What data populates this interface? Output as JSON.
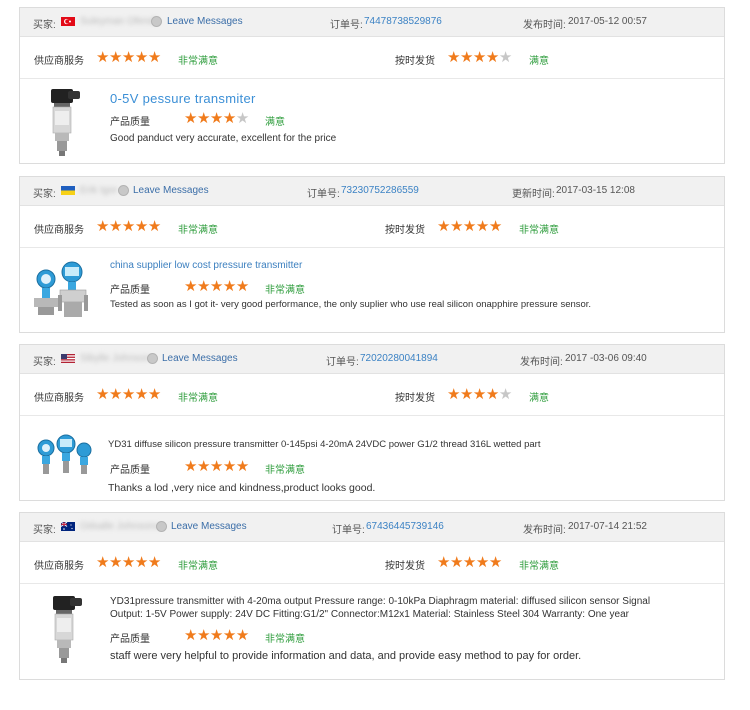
{
  "labels": {
    "buyer": "买家:",
    "leave_messages": "Leave Messages",
    "order_no": "订单号:",
    "supplier_service": "供应商服务",
    "on_time": "按时发货",
    "product_quality": "产品质量"
  },
  "colors": {
    "star_on": "#f07b1c",
    "star_off": "#c7c7c7",
    "verdict": "#2f9d3d",
    "link": "#3b82c4"
  },
  "reviews": [
    {
      "buyer_country": "turkey-flag-icon",
      "buyer_name": "Suleyman Ofendi",
      "order_number": "74478738529876",
      "date_label": "发布时间:",
      "date_value": "2017-05-12 00:57",
      "supplier_stars": 5,
      "supplier_verdict": "非常满意",
      "delivery_stars": 4,
      "delivery_verdict": "满意",
      "product_title": "0-5V  pessure  transmiter",
      "quality_stars": 4,
      "quality_verdict": "满意",
      "review_text": "Good panduct very accurate, excellent for the price",
      "thumb": "pressure-transmitter-image"
    },
    {
      "buyer_country": "ukraine-flag-icon",
      "buyer_name": "Erik Igor",
      "order_number": "73230752286559",
      "date_label": "更新时间:",
      "date_value": "2017-03-15 12:08",
      "supplier_stars": 5,
      "supplier_verdict": "非常满意",
      "delivery_stars": 5,
      "delivery_verdict": "非常满意",
      "product_title": "china supplier low cost pressure transmitter",
      "quality_stars": 5,
      "quality_verdict": "非常满意",
      "review_text": "Tested as soon as I got it- very good performance, the only suplier who use real silicon onapphire pressure sensor.",
      "thumb": "smart-transmitter-image"
    },
    {
      "buyer_country": "usa-flag-icon",
      "buyer_name": "Sibylle Johnson",
      "order_number": "72020280041894",
      "date_label": "发布时间:",
      "date_value": "2017 -03-06 09:40",
      "supplier_stars": 5,
      "supplier_verdict": "非常满意",
      "delivery_stars": 4,
      "delivery_verdict": "满意",
      "product_title": "YD31 diffuse silicon pressure transmitter 0-145psi 4-20mA 24VDC power G1/2 thread 316L wetted part",
      "quality_stars": 5,
      "quality_verdict": "非常满意",
      "review_text": "Thanks  a  lod  ,very  nice  and   kindness,product  looks  good.",
      "thumb": "blue-transmitter-image"
    },
    {
      "buyer_country": "australia-flag-icon",
      "buyer_name": "Odsalle Johnsons",
      "order_number": "67436445739146",
      "date_label": "发布时间:",
      "date_value": "2017-07-14 21:52",
      "supplier_stars": 5,
      "supplier_verdict": "非常满意",
      "delivery_stars": 5,
      "delivery_verdict": "非常满意",
      "product_title_line1": "YD31pressure transmitter with 4-20ma output Pressure range: 0-10kPa Diaphragm material: diffused silicon sensor Signal",
      "product_title_line2": "Output: 1-5V Power supply: 24V DC Fitting:G1/2\" Connector:M12x1 Material: Stainless Steel 304 Warranty: One year",
      "quality_stars": 5,
      "quality_verdict": "非常满意",
      "review_text": "staff were very helpful to provide information and data, and provide easy method to pay for order.",
      "thumb": "pressure-transmitter-image"
    }
  ]
}
